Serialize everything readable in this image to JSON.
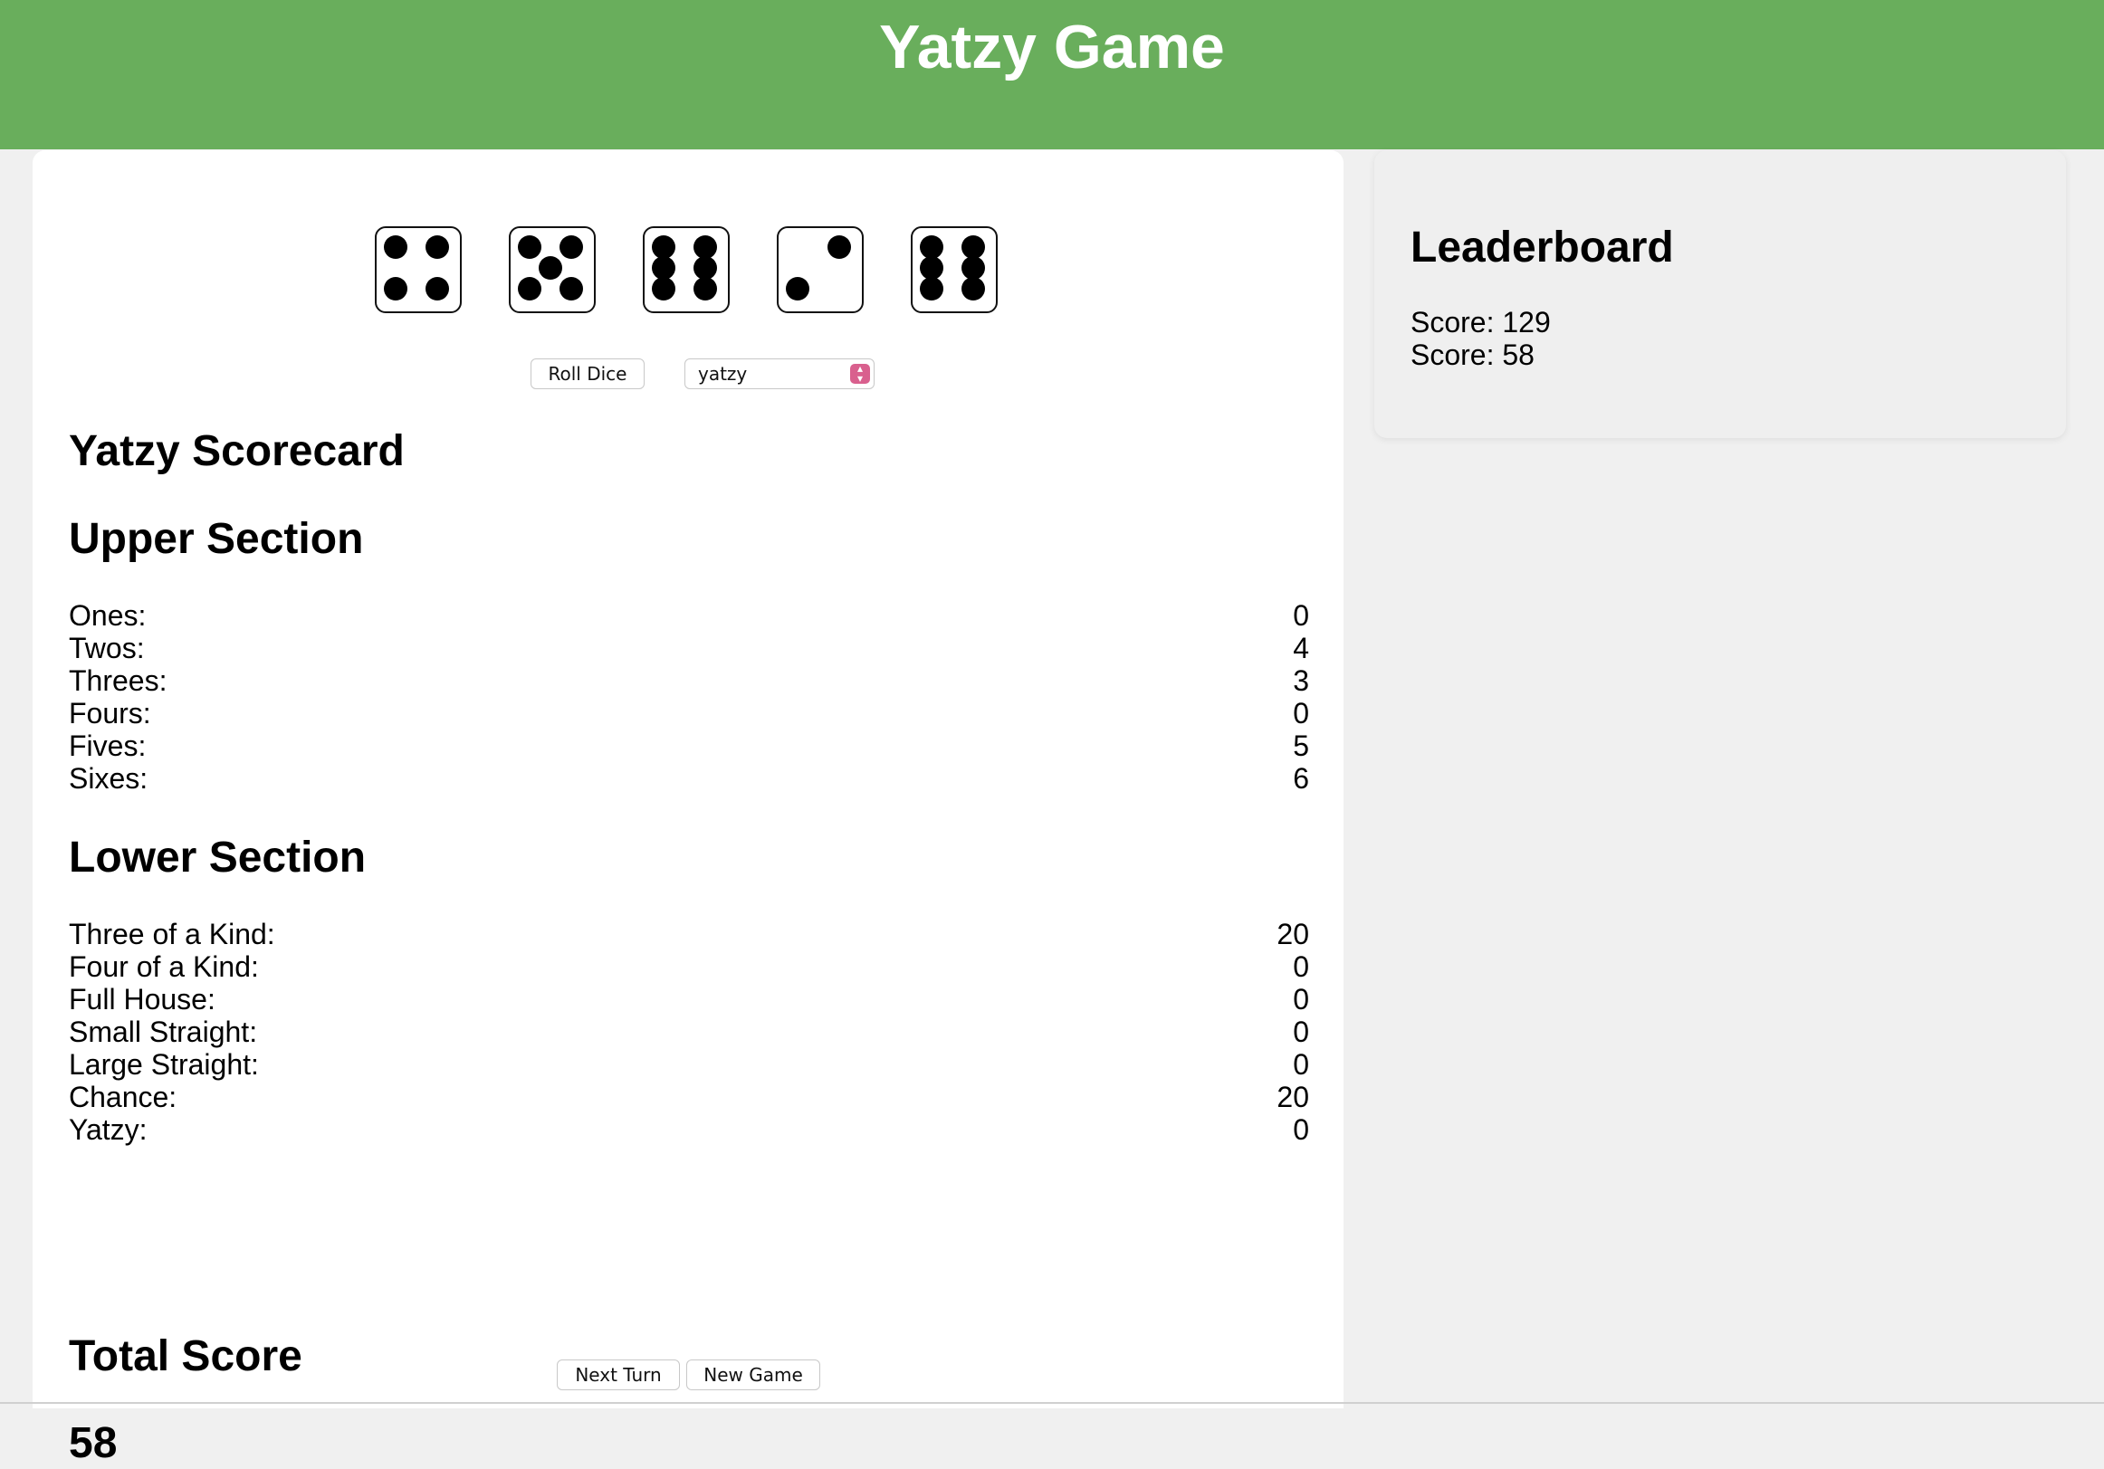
{
  "header": {
    "title": "Yatzy Game"
  },
  "dice": [
    4,
    5,
    6,
    2,
    6
  ],
  "controls": {
    "roll_label": "Roll Dice",
    "category_selected": "yatzy"
  },
  "scorecard": {
    "title": "Yatzy Scorecard",
    "upper": {
      "title": "Upper Section",
      "rows": [
        {
          "label": "Ones:",
          "value": "0"
        },
        {
          "label": "Twos:",
          "value": "4"
        },
        {
          "label": "Threes:",
          "value": "3"
        },
        {
          "label": "Fours:",
          "value": "0"
        },
        {
          "label": "Fives:",
          "value": "5"
        },
        {
          "label": "Sixes:",
          "value": "6"
        }
      ]
    },
    "lower": {
      "title": "Lower Section",
      "rows": [
        {
          "label": "Three of a Kind:",
          "value": "20"
        },
        {
          "label": "Four of a Kind:",
          "value": "0"
        },
        {
          "label": "Full House:",
          "value": "0"
        },
        {
          "label": "Small Straight:",
          "value": "0"
        },
        {
          "label": "Large Straight:",
          "value": "0"
        },
        {
          "label": "Chance:",
          "value": "20"
        },
        {
          "label": "Yatzy:",
          "value": "0"
        }
      ]
    },
    "total": {
      "title": "Total Score",
      "value": "58"
    }
  },
  "footer": {
    "next_turn_label": "Next Turn",
    "new_game_label": "New Game"
  },
  "leaderboard": {
    "title": "Leaderboard",
    "entries": [
      "Score: 129",
      "Score: 58"
    ]
  }
}
